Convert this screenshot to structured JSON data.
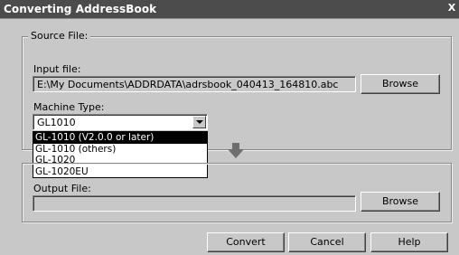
{
  "window": {
    "title": "Converting AddressBook",
    "close_symbol": "X"
  },
  "source_group": {
    "legend": "Source File:",
    "input_label": "Input file:",
    "input_value": "E:\\My Documents\\ADDRDATA\\adrsbook_040413_164810.abc",
    "browse_label": "Browse",
    "machine_type_label": "Machine Type:",
    "machine_type_value": "GL1010",
    "options": [
      {
        "label": "GL-1010 (V2.0.0 or later)",
        "selected": true
      },
      {
        "label": "GL-1010 (others)",
        "selected": false
      },
      {
        "label": "GL-1020",
        "selected": false
      },
      {
        "label": "GL-1020EU",
        "selected": false
      }
    ]
  },
  "output_group": {
    "output_label": "Output File:",
    "output_value": "",
    "browse_label": "Browse"
  },
  "buttons": {
    "convert": "Convert",
    "cancel": "Cancel",
    "help": "Help"
  },
  "icons": {
    "convert_arrow": "down-arrow-icon",
    "dropdown": "chevron-down-icon"
  }
}
